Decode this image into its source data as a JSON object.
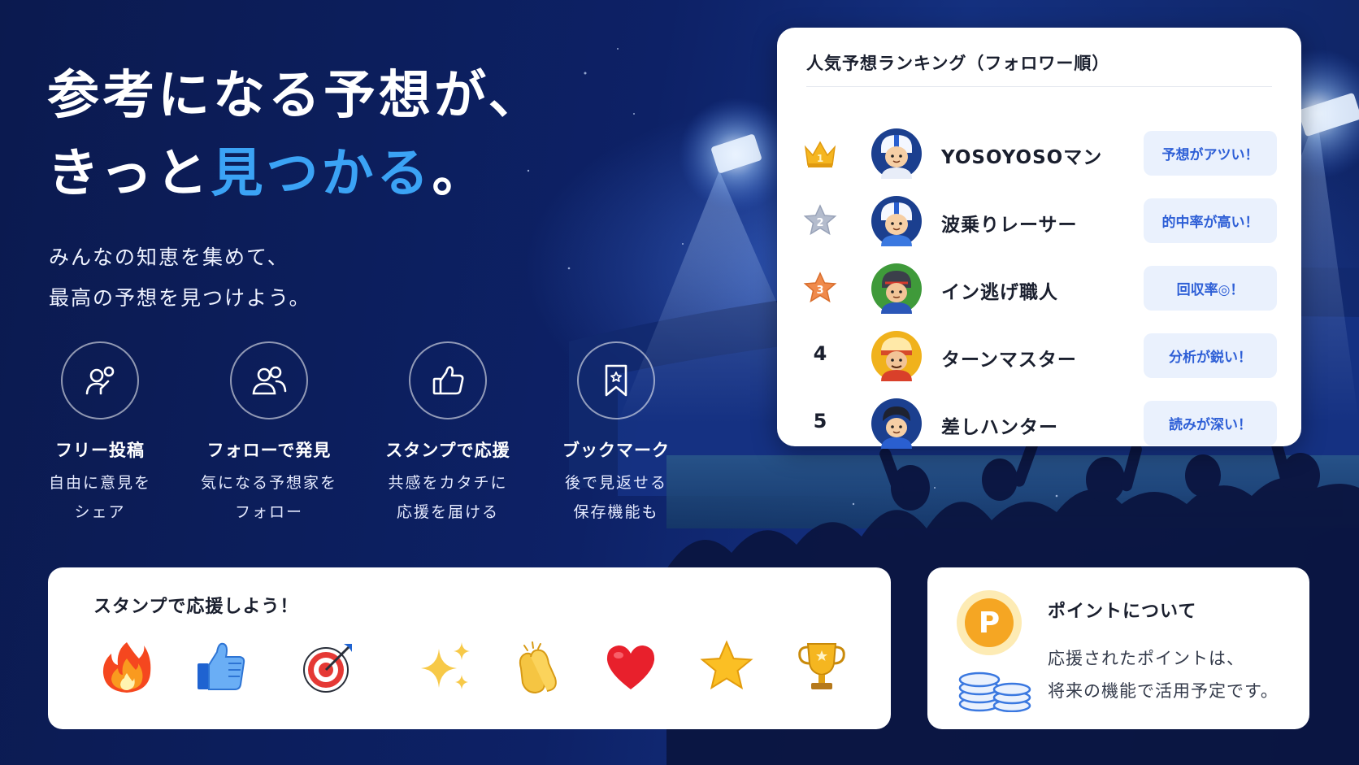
{
  "hero": {
    "title_line1": "参考になる予想が、",
    "title_line2_pre": "きっと",
    "title_line2_highlight": "見つかる",
    "title_line2_post": "。",
    "subtitle_line1": "みんなの知恵を集めて、",
    "subtitle_line2": "最高の予想を見つけよう。"
  },
  "features": [
    {
      "icon": "user-post-icon",
      "title": "フリー投稿",
      "desc1": "自由に意見を",
      "desc2": "シェア"
    },
    {
      "icon": "users-icon",
      "title": "フォローで発見",
      "desc1": "気になる予想家を",
      "desc2": "フォロー"
    },
    {
      "icon": "thumbs-up-icon",
      "title": "スタンプで応援",
      "desc1": "共感をカタチに",
      "desc2": "応援を届ける"
    },
    {
      "icon": "bookmark-icon",
      "title": "ブックマーク",
      "desc1": "後で見返せる",
      "desc2": "保存機能も"
    }
  ],
  "ranking": {
    "title": "人気予想ランキング（フォロワー順）",
    "rows": [
      {
        "rank": "1",
        "badge": "gold-crown-icon",
        "name": "YOSOYOSOマン",
        "tag": "予想がアツい！",
        "avatar_color": "#1b3f8f"
      },
      {
        "rank": "2",
        "badge": "silver-star-icon",
        "name": "波乗りレーサー",
        "tag": "的中率が高い！",
        "avatar_color": "#1b3f8f"
      },
      {
        "rank": "3",
        "badge": "bronze-star-icon",
        "name": "イン逃げ職人",
        "tag": "回収率◎！",
        "avatar_color": "#3f9a3a"
      },
      {
        "rank": "4",
        "badge": "",
        "name": "ターンマスター",
        "tag": "分析が鋭い！",
        "avatar_color": "#f0b21c"
      },
      {
        "rank": "5",
        "badge": "",
        "name": "差しハンター",
        "tag": "読みが深い！",
        "avatar_color": "#1b3f8f"
      }
    ]
  },
  "stamps": {
    "title": "スタンプで応援しよう！",
    "items": [
      "fire-icon",
      "thumbs-up-stamp-icon",
      "target-icon",
      "sparkles-icon",
      "clap-icon",
      "heart-icon",
      "star-icon",
      "trophy-icon"
    ]
  },
  "points": {
    "title": "ポイントについて",
    "desc_line1": "応援されたポイントは、",
    "desc_line2": "将来の機能で活用予定です。",
    "coin_letter": "P"
  },
  "colors": {
    "accent": "#3ba3f5",
    "tag_bg": "#eaf1fd",
    "tag_text": "#2e5fd6",
    "gold": "#f5b620",
    "silver": "#a8b0c4",
    "bronze": "#f08a4b"
  }
}
